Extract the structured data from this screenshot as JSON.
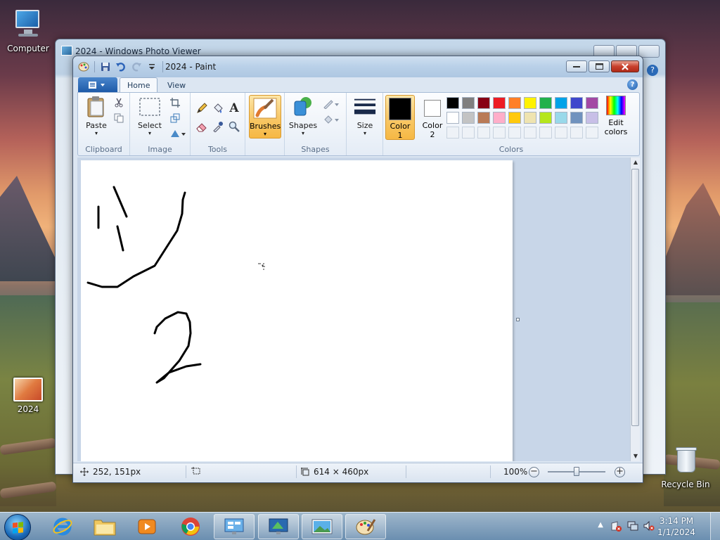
{
  "desktop": {
    "icons": [
      {
        "label": "Computer"
      },
      {
        "label": "2024"
      },
      {
        "label": "Recycle Bin"
      }
    ]
  },
  "photo_viewer": {
    "title": "2024 - Windows Photo Viewer"
  },
  "paint": {
    "title": "2024 - Paint",
    "tabs": [
      {
        "label": "Home",
        "active": true
      },
      {
        "label": "View",
        "active": false
      }
    ],
    "ribbon": {
      "clipboard": {
        "label": "Clipboard",
        "paste": "Paste"
      },
      "image": {
        "label": "Image",
        "select": "Select"
      },
      "tools": {
        "label": "Tools"
      },
      "brushes": "Brushes",
      "shapes": {
        "label": "Shapes",
        "button": "Shapes"
      },
      "size": "Size",
      "colors": {
        "label": "Colors",
        "color1_line1": "Color",
        "color1_line2": "1",
        "color2_line1": "Color",
        "color2_line2": "2",
        "edit_line1": "Edit",
        "edit_line2": "colors",
        "color1_value": "#000000",
        "color2_value": "#ffffff",
        "palette": [
          "#000000",
          "#7f7f7f",
          "#880015",
          "#ed1c24",
          "#ff7f27",
          "#fff200",
          "#22b14c",
          "#00a2e8",
          "#3f48cc",
          "#a349a4",
          "#ffffff",
          "#c3c3c3",
          "#b97a57",
          "#ffaec9",
          "#ffc90e",
          "#efe4b0",
          "#b5e61d",
          "#99d9ea",
          "#7092be",
          "#c8bfe7",
          "",
          "",
          "",
          "",
          "",
          "",
          "",
          "",
          "",
          ""
        ]
      }
    },
    "status": {
      "cursor_pos": "252, 151px",
      "image_size": "614 × 460px",
      "zoom": "100%",
      "zoom_fraction": 0.5
    }
  },
  "taskbar": {
    "time": "3:14 PM",
    "date": "1/1/2024"
  }
}
